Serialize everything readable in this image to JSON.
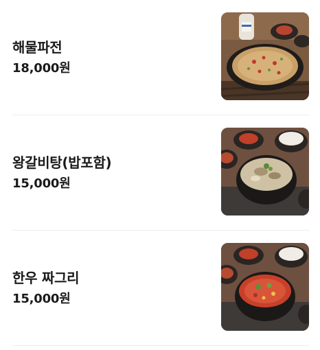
{
  "menu": {
    "items": [
      {
        "name": "해물파전",
        "price": "18,000원",
        "image": "seafood-pancake-photo"
      },
      {
        "name": "왕갈비탕(밥포함)",
        "price": "15,000원",
        "image": "galbitang-photo"
      },
      {
        "name": "한우 짜그리",
        "price": "15,000원",
        "image": "jjageuri-stew-photo"
      }
    ]
  },
  "colors": {
    "text": "#1a1a1a",
    "divider": "#ececec"
  }
}
